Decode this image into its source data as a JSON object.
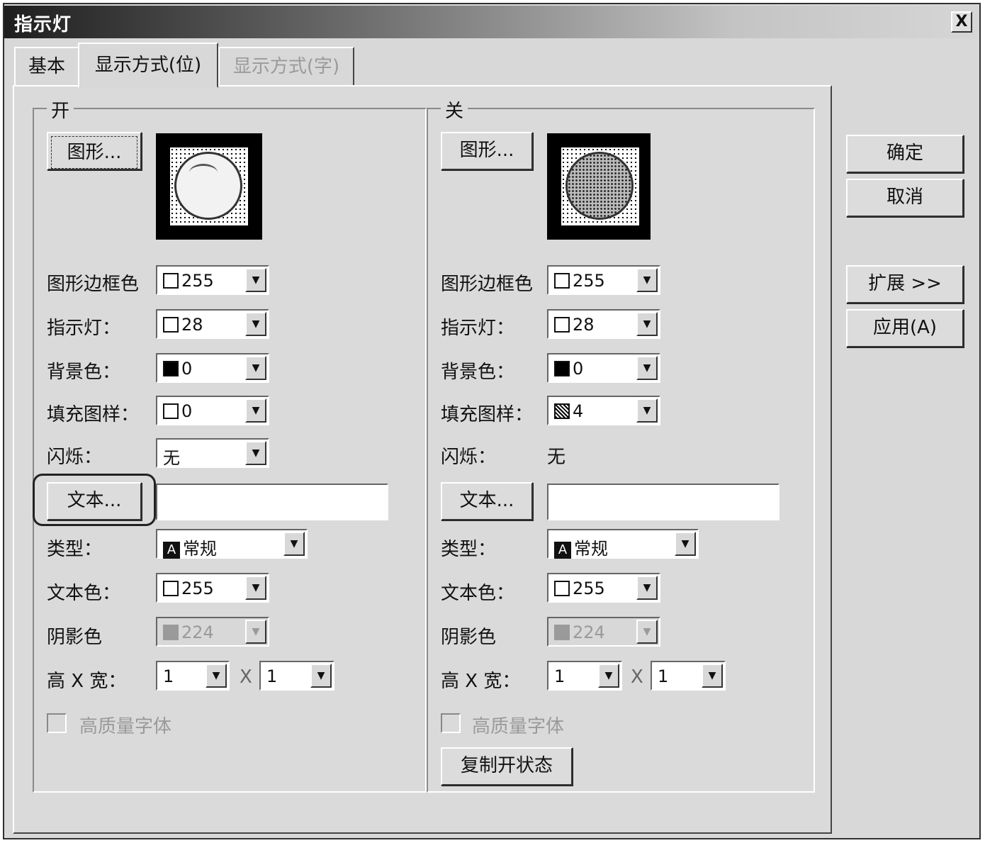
{
  "window": {
    "title": "指示灯",
    "close_label": "X"
  },
  "tabs": [
    {
      "label": "基本",
      "state": "normal"
    },
    {
      "label": "显示方式(位)",
      "state": "active"
    },
    {
      "label": "显示方式(字)",
      "state": "disabled"
    }
  ],
  "side_buttons": {
    "ok": "确定",
    "cancel": "取消",
    "expand": "扩展 >>",
    "apply": "应用(A)"
  },
  "on_group": {
    "legend": "开",
    "graphic_button": "图形...",
    "border_color_label": "图形边框色",
    "border_color_value": "255",
    "indicator_label": "指示灯：",
    "indicator_value": "28",
    "background_label": "背景色：",
    "background_value": "0",
    "fill_label": "填充图样：",
    "fill_value": "0",
    "blink_label": "闪烁：",
    "blink_value": "无",
    "text_button": "文本...",
    "text_value": "",
    "type_label": "类型：",
    "type_glyph": "A",
    "type_value": "常规",
    "text_color_label": "文本色：",
    "text_color_value": "255",
    "shadow_label": "阴影色",
    "shadow_value": "224",
    "size_label": "高 X 宽：",
    "height_value": "1",
    "times_sign": "X",
    "width_value": "1",
    "hq_label": "高质量字体"
  },
  "off_group": {
    "legend": "关",
    "graphic_button": "图形...",
    "border_color_label": "图形边框色",
    "border_color_value": "255",
    "indicator_label": "指示灯：",
    "indicator_value": "28",
    "background_label": "背景色：",
    "background_value": "0",
    "fill_label": "填充图样：",
    "fill_value": "4",
    "blink_label": "闪烁：",
    "blink_value": "无",
    "text_button": "文本...",
    "text_value": "",
    "type_label": "类型：",
    "type_glyph": "A",
    "type_value": "常规",
    "text_color_label": "文本色：",
    "text_color_value": "255",
    "shadow_label": "阴影色",
    "shadow_value": "224",
    "size_label": "高 X 宽：",
    "height_value": "1",
    "times_sign": "X",
    "width_value": "1",
    "hq_label": "高质量字体",
    "copy_button": "复制开状态"
  }
}
